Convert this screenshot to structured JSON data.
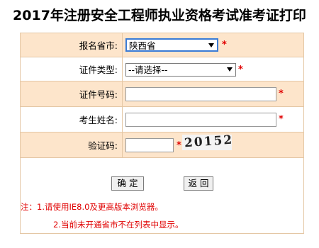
{
  "title": "2017年注册安全工程师执业资格考试准考证打印",
  "form": {
    "province": {
      "label": "报名省市:",
      "value": "陕西省"
    },
    "cert_type": {
      "label": "证件类型:",
      "value": "--请选择--"
    },
    "cert_number": {
      "label": "证件号码:",
      "value": ""
    },
    "name": {
      "label": "考生姓名:",
      "value": ""
    },
    "captcha": {
      "label": "验证码:",
      "value": "",
      "image_text": "20152"
    },
    "required_mark": "*"
  },
  "buttons": {
    "confirm": "确 定",
    "back": "返 回"
  },
  "notes": {
    "line1": "注：1.请使用IE8.0及更高版本浏览器。",
    "line2": "2.当前未开通省市不在列表中显示。"
  },
  "colors": {
    "row_shaded": "#fde5cb",
    "border": "#e4c7a5",
    "required": "#e00000"
  }
}
